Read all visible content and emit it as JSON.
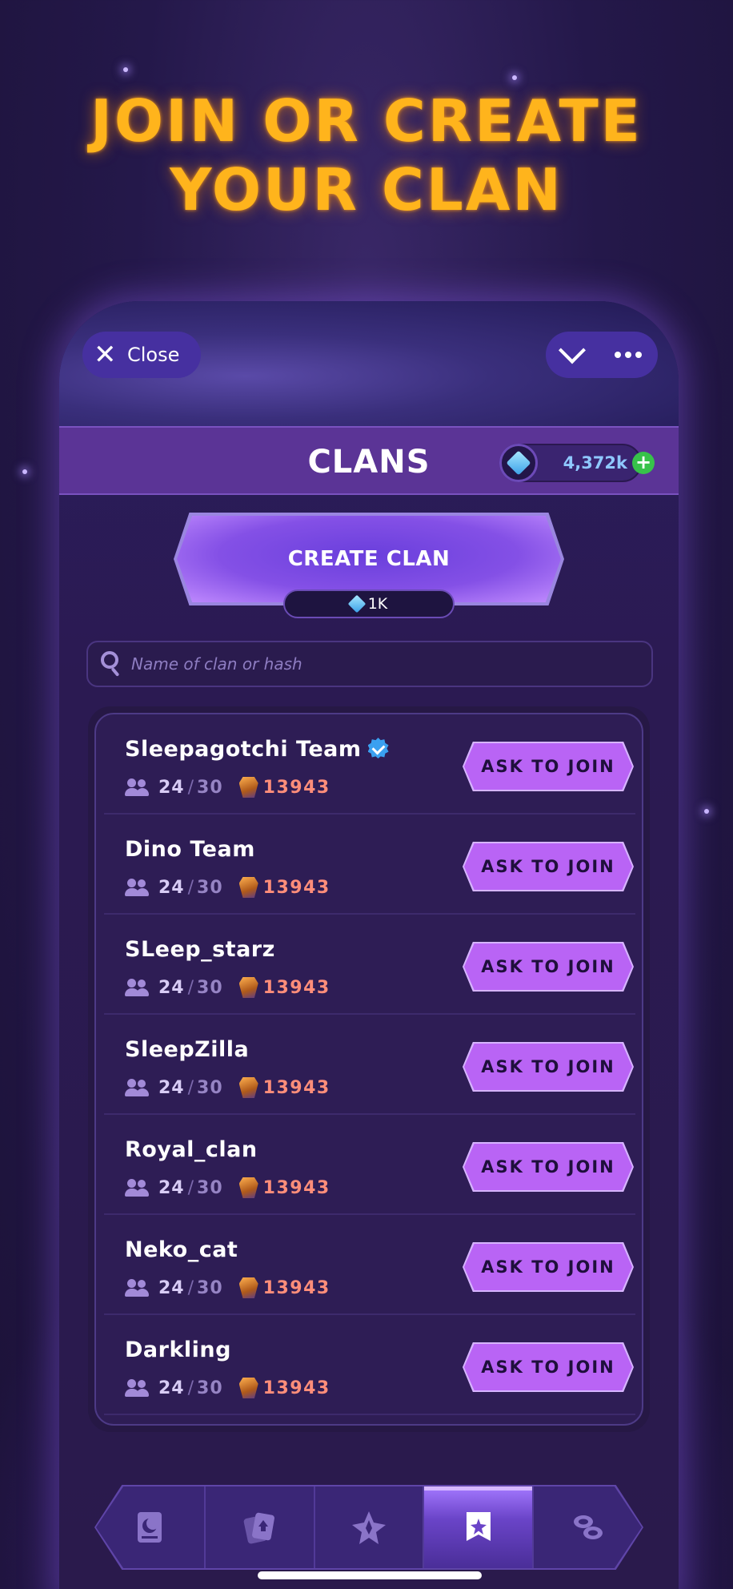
{
  "headline": {
    "line1": "JOIN OR CREATE",
    "line2": "YOUR CLAN"
  },
  "topbar": {
    "close_label": "Close"
  },
  "header": {
    "title": "CLANS",
    "gem_balance": "4,372k"
  },
  "create": {
    "button_label": "CREATE CLAN",
    "cost": "1K"
  },
  "search": {
    "placeholder": "Name of clan or hash"
  },
  "clans": [
    {
      "name": "Sleepagotchi Team",
      "verified": true,
      "members": "24",
      "max": "30",
      "score": "13943",
      "action": "ASK TO JOIN"
    },
    {
      "name": "Dino Team",
      "verified": false,
      "members": "24",
      "max": "30",
      "score": "13943",
      "action": "ASK TO JOIN"
    },
    {
      "name": "SLeep_starz",
      "verified": false,
      "members": "24",
      "max": "30",
      "score": "13943",
      "action": "ASK TO JOIN"
    },
    {
      "name": "SleepZilla",
      "verified": false,
      "members": "24",
      "max": "30",
      "score": "13943",
      "action": "ASK TO JOIN"
    },
    {
      "name": "Royal_clan",
      "verified": false,
      "members": "24",
      "max": "30",
      "score": "13943",
      "action": "ASK TO JOIN"
    },
    {
      "name": "Neko_cat",
      "verified": false,
      "members": "24",
      "max": "30",
      "score": "13943",
      "action": "ASK TO JOIN"
    },
    {
      "name": "Darkling",
      "verified": false,
      "members": "24",
      "max": "30",
      "score": "13943",
      "action": "ASK TO JOIN"
    }
  ],
  "nav": {
    "active": "clans",
    "tabs": [
      {
        "id": "sleep",
        "icon": "moon-card-icon"
      },
      {
        "id": "cards",
        "icon": "card-stack-icon"
      },
      {
        "id": "summon",
        "icon": "crystal-star-icon"
      },
      {
        "id": "clans",
        "icon": "clan-banner-icon"
      },
      {
        "id": "shop",
        "icon": "coins-icon"
      }
    ]
  },
  "colors": {
    "headline": "#ffb41c",
    "accent": "#b964f5",
    "score": "#ff8e7a",
    "background": "#24184a"
  }
}
